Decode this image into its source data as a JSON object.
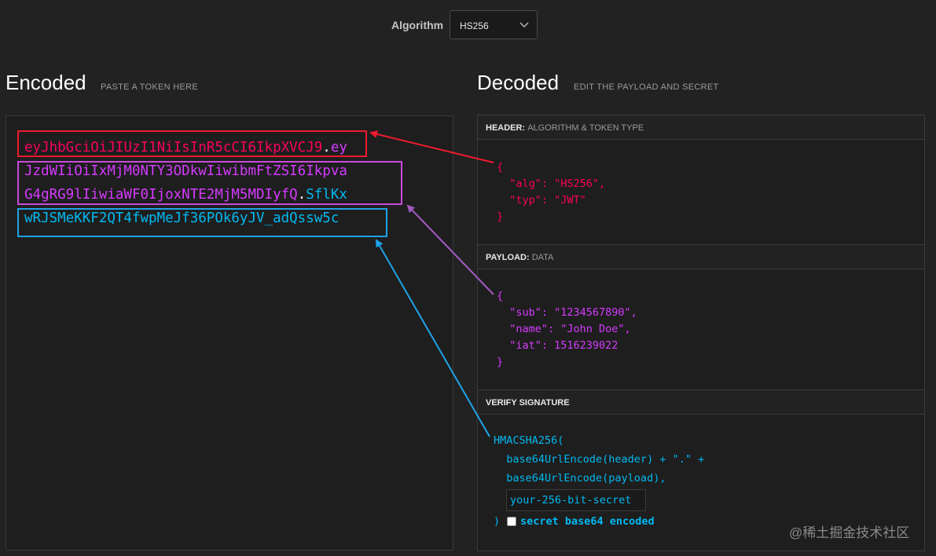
{
  "algorithm": {
    "label": "Algorithm",
    "value": "HS256"
  },
  "encoded": {
    "title": "Encoded",
    "subtitle": "PASTE A TOKEN HERE",
    "lines": [
      {
        "header": "eyJhbGciOiJIUzI1NiIsInR5cCI6IkpXVCJ9",
        "dot": ".",
        "payload": "ey"
      },
      {
        "payload": "JzdWIiOiIxMjM0NTY3ODkwIiwibmFtZSI6Ikpva"
      },
      {
        "payload": "G4gRG9lIiwiaWF0IjoxNTE2MjM5MDIyfQ",
        "dot": ".",
        "signature": "SflKx"
      },
      {
        "signature": "wRJSMeKKF2QT4fwpMeJf36POk6yJV_adQssw5c"
      }
    ]
  },
  "decoded": {
    "title": "Decoded",
    "subtitle": "EDIT THE PAYLOAD AND SECRET",
    "header_section": {
      "label": "HEADER:",
      "sublabel": "ALGORITHM & TOKEN TYPE",
      "lines": [
        "{",
        "  \"alg\": \"HS256\",",
        "  \"typ\": \"JWT\"",
        "}"
      ]
    },
    "payload_section": {
      "label": "PAYLOAD:",
      "sublabel": "DATA",
      "lines": [
        "{",
        "  \"sub\": \"1234567890\",",
        "  \"name\": \"John Doe\",",
        "  \"iat\": 1516239022",
        "}"
      ]
    },
    "signature_section": {
      "label": "VERIFY SIGNATURE",
      "lines": [
        "HMACSHA256(",
        "  base64UrlEncode(header) + \".\" +",
        "  base64UrlEncode(payload),"
      ],
      "secret_placeholder": "your-256-bit-secret",
      "close_paren": ")",
      "checkbox_label": "secret base64 encoded"
    }
  },
  "colors": {
    "header": "#fb015b",
    "payload": "#d63aff",
    "signature": "#00b9f1"
  },
  "watermark": "@稀土掘金技术社区"
}
